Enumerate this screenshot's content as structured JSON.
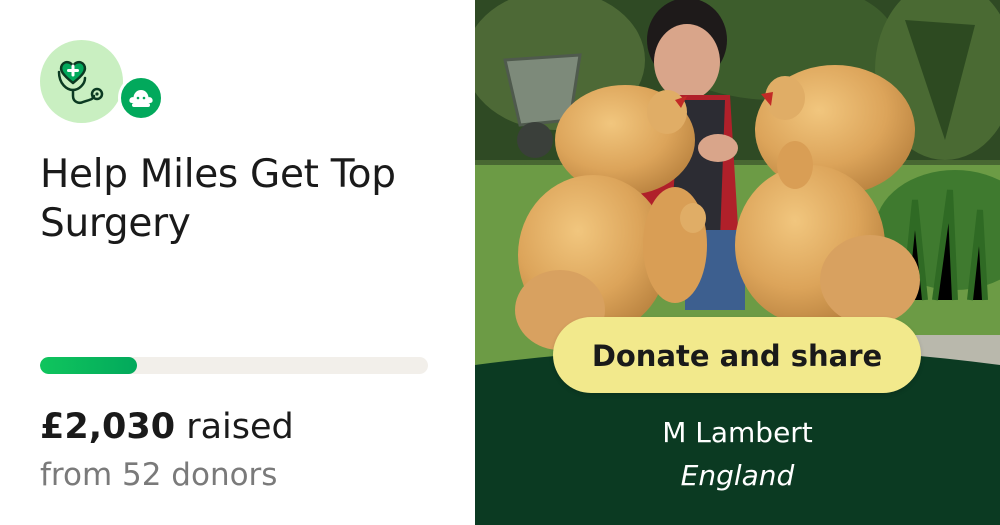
{
  "campaign": {
    "title": "Help Miles Get Top Surgery",
    "category_icon": "heart-stethoscope-icon",
    "badge_icon": "gofundme-logo-icon"
  },
  "progress": {
    "fraction": 0.25,
    "amount_raised": "£2,030",
    "raised_word": "raised",
    "donors_text": "from 52 donors"
  },
  "cta": {
    "donate_label": "Donate and share"
  },
  "organizer": {
    "name": "M Lambert",
    "location": "England"
  },
  "colors": {
    "brand_green": "#02a95c",
    "light_green": "#c9efc1",
    "dark_green": "#0b3a22",
    "button_yellow": "#f2e98c"
  }
}
